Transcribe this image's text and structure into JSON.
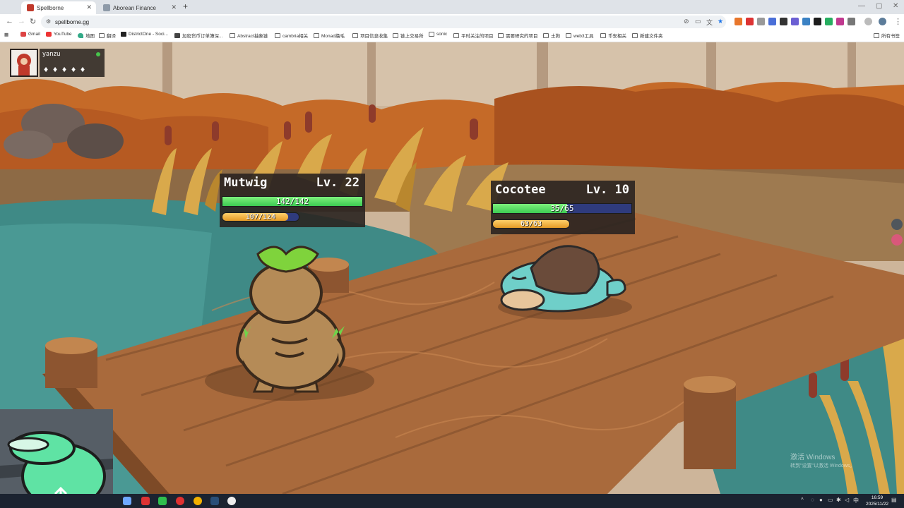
{
  "browser": {
    "tabs": [
      {
        "title": "Spellborne",
        "active": true,
        "favicon_color": "#c0392b"
      },
      {
        "title": "Aborean Finance",
        "active": false,
        "favicon_color": "#8e9aa8"
      }
    ],
    "url": "spellborne.gg",
    "bookmarks": [
      {
        "label": "Gmail",
        "icon": "gmail-icon"
      },
      {
        "label": "YouTube",
        "icon": "youtube-icon"
      },
      {
        "label": "地图",
        "icon": "maps-icon"
      },
      {
        "label": "翻译",
        "icon": "folder-icon"
      },
      {
        "label": "DistrictOne - Soci...",
        "icon": "districtone-icon"
      },
      {
        "label": "加密货币订单簿深...",
        "icon": "site-icon"
      },
      {
        "label": "Abstract抽象链",
        "icon": "folder-icon"
      },
      {
        "label": "cambria相关",
        "icon": "folder-icon"
      },
      {
        "label": "Monad撸毛",
        "icon": "folder-icon"
      },
      {
        "label": "项目信息收集",
        "icon": "folder-icon"
      },
      {
        "label": "链上交易所",
        "icon": "folder-icon"
      },
      {
        "label": "sonic",
        "icon": "folder-icon"
      },
      {
        "label": "平时关注的项目",
        "icon": "folder-icon"
      },
      {
        "label": "需要研究的项目",
        "icon": "folder-icon"
      },
      {
        "label": "土狗",
        "icon": "folder-icon"
      },
      {
        "label": "web3工具",
        "icon": "folder-icon"
      },
      {
        "label": "币安相关",
        "icon": "folder-icon"
      },
      {
        "label": "新建文件夹",
        "icon": "folder-icon"
      }
    ],
    "all_bookmarks": "所有书签"
  },
  "game": {
    "player": {
      "name": "yanzu",
      "status": "online",
      "party_slots": [
        "♦",
        "♦",
        "♦",
        "♦",
        "♦"
      ]
    },
    "ally": {
      "name": "Mutwig",
      "level": "Lv. 22",
      "hp_text": "142/142",
      "hp_fraction": 1.0,
      "xp_text": "107/124",
      "xp_fraction": 0.863
    },
    "enemy": {
      "name": "Cocotee",
      "level": "Lv. 10",
      "hp_text": "35/65",
      "hp_fraction": 0.538,
      "xp_text": "63/63",
      "xp_fraction": 1.0
    }
  },
  "watermark": {
    "line1": "激活 Windows",
    "line2": "转到\"设置\"以激活 Windows。"
  },
  "taskbar": {
    "time": "16:59",
    "date": "2025/11/22",
    "ime": "中"
  },
  "colors": {
    "hp_green": "#3dcb52",
    "hp_track": "#2f3b7d",
    "xp_orange": "#e49b27",
    "panel_bg": "#2a2420"
  }
}
